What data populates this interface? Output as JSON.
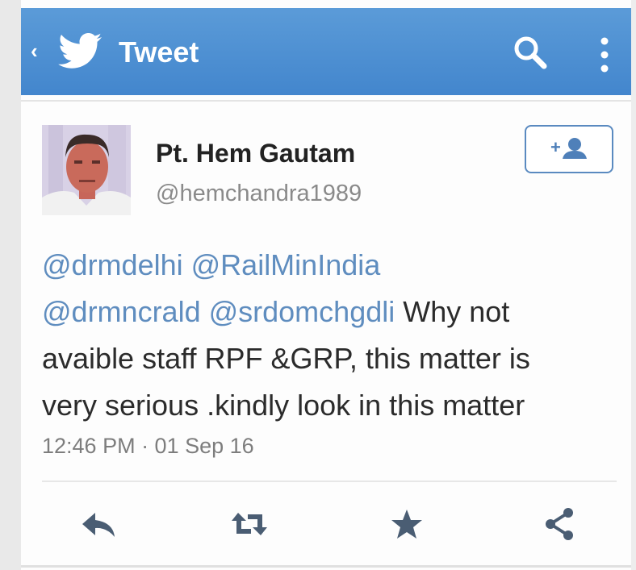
{
  "appbar": {
    "title": "Tweet",
    "back_icon": "chevron-left-icon",
    "logo_icon": "twitter-bird-icon",
    "search_icon": "search-icon",
    "more_icon": "more-vertical-icon",
    "color": "#4a8dd1"
  },
  "tweet": {
    "author_name": "Pt. Hem Gautam",
    "author_handle": "@hemchandra1989",
    "follow_icon": "add-user-icon",
    "mentions": [
      "@drmdelhi",
      "@RailMinIndia",
      "@drmncrald",
      "@srdomchgdli"
    ],
    "text_line3_prefix": " Why not",
    "text_line3": "avaible staff RPF &GRP, this matter is",
    "text_line4": "very serious .kindly look in this matter",
    "timestamp": "12:46 PM · 01 Sep 16",
    "mention_color": "#5f8dbf"
  },
  "actions": {
    "reply_icon": "reply-icon",
    "retweet_icon": "retweet-icon",
    "favorite_icon": "star-icon",
    "share_icon": "share-icon"
  }
}
